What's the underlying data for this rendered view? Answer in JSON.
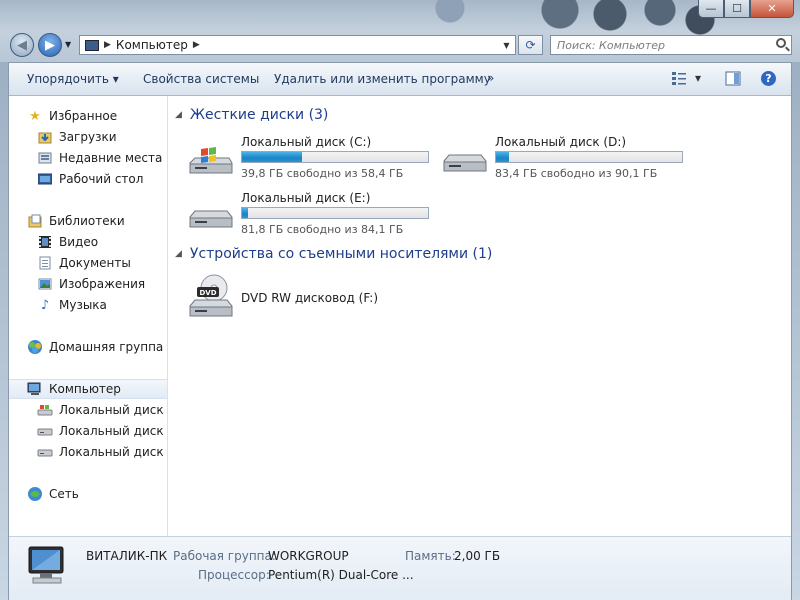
{
  "window": {
    "caption": {
      "minimize": "—",
      "maximize": "☐",
      "close": "✕"
    }
  },
  "nav": {
    "back_glyph": "◀",
    "forward_glyph": "▶",
    "recent_glyph": "▼",
    "address": {
      "sep1": "▶",
      "location": "Компьютер",
      "sep2": "▶",
      "dropdown": "▼"
    },
    "refresh_glyph": "⟳",
    "search": {
      "placeholder": "Поиск: Компьютер"
    }
  },
  "toolbar": {
    "organize": "Упорядочить ▾",
    "system_properties": "Свойства системы",
    "uninstall": "Удалить или изменить программу",
    "more": "»",
    "view_dropdown": "▾",
    "help": "?"
  },
  "sidebar": {
    "favorites": {
      "label": "Избранное",
      "items": [
        {
          "label": "Загрузки",
          "icon": "downloads-icon"
        },
        {
          "label": "Недавние места",
          "icon": "recent-places-icon"
        },
        {
          "label": "Рабочий стол",
          "icon": "desktop-icon"
        }
      ]
    },
    "libraries": {
      "label": "Библиотеки",
      "items": [
        {
          "label": "Видео",
          "icon": "video-icon"
        },
        {
          "label": "Документы",
          "icon": "documents-icon"
        },
        {
          "label": "Изображения",
          "icon": "pictures-icon"
        },
        {
          "label": "Музыка",
          "icon": "music-icon"
        }
      ]
    },
    "homegroup": {
      "label": "Домашняя группа"
    },
    "computer": {
      "label": "Компьютер",
      "items": [
        {
          "label": "Локальный диск (C:)"
        },
        {
          "label": "Локальный диск (D:)"
        },
        {
          "label": "Локальный диск (E:)"
        }
      ]
    },
    "network": {
      "label": "Сеть"
    }
  },
  "main": {
    "hard_disks": {
      "header": "Жесткие диски (3)",
      "drives": [
        {
          "name": "Локальный диск (C:)",
          "free_text": "39,8 ГБ свободно из 58,4 ГБ",
          "used_fraction": 0.32,
          "system": true
        },
        {
          "name": "Локальный диск (D:)",
          "free_text": "83,4 ГБ свободно из 90,1 ГБ",
          "used_fraction": 0.07,
          "system": false
        },
        {
          "name": "Локальный диск (E:)",
          "free_text": "81,8 ГБ свободно из 84,1 ГБ",
          "used_fraction": 0.03,
          "system": false
        }
      ]
    },
    "removable": {
      "header": "Устройства со съемными носителями (1)",
      "devices": [
        {
          "name": "DVD RW дисковод (F:)",
          "badge": "DVD"
        }
      ]
    }
  },
  "details": {
    "computer_name": "ВИТАЛИК-ПК",
    "workgroup_label": "Рабочая группа:",
    "workgroup_value": "WORKGROUP",
    "memory_label": "Память:",
    "memory_value": "2,00 ГБ",
    "cpu_label": "Процессор:",
    "cpu_value": "Pentium(R) Dual-Core ..."
  },
  "colors": {
    "accent": "#1e3e8c",
    "bar_fill": "#1a84c6",
    "link": "#1e395b"
  }
}
